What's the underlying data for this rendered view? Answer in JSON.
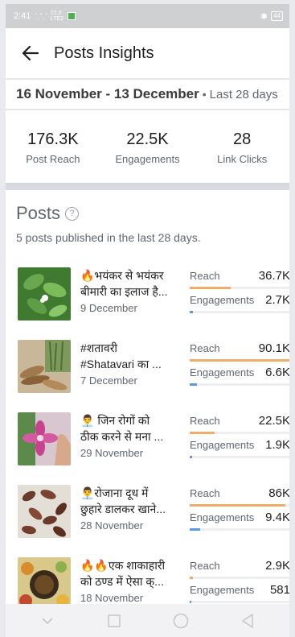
{
  "status_bar": {
    "time": "2:41",
    "signal": "⸪⸪",
    "network_top": "22.0",
    "network_bottom": "LTE2",
    "bluetooth": "✱",
    "battery": "44"
  },
  "header": {
    "title": "Posts Insights"
  },
  "date_range": {
    "dates": "16 November - 13 December",
    "dot": "•",
    "period": "Last 28 days"
  },
  "summary": [
    {
      "value": "176.3K",
      "label": "Post Reach"
    },
    {
      "value": "22.5K",
      "label": "Engagements"
    },
    {
      "value": "28",
      "label": "Link Clicks"
    }
  ],
  "posts_section": {
    "title": "Posts",
    "help": "?",
    "subtitle": "5 posts published in the last 28 days."
  },
  "posts": [
    {
      "line1": "🔥भयंकर से भयंकर",
      "line2": "बीमारी का इलाज है...",
      "date": "9 December",
      "reach_label": "Reach",
      "reach": "36.7K",
      "reach_fraction": 0.41,
      "eng_label": "Engagements",
      "engagements": "2.7K",
      "eng_fraction": 0.03
    },
    {
      "line1": "#शतावरी",
      "line2": "#Shatavari का ...",
      "date": "7 December",
      "reach_label": "Reach",
      "reach": "90.1K",
      "reach_fraction": 1.0,
      "eng_label": "Engagements",
      "engagements": "6.6K",
      "eng_fraction": 0.07
    },
    {
      "line1": "👨‍💼 जिन रोगों को",
      "line2": "ठीक करने से मना ...",
      "date": "29 November",
      "reach_label": "Reach",
      "reach": "22.5K",
      "reach_fraction": 0.25,
      "eng_label": "Engagements",
      "engagements": "1.9K",
      "eng_fraction": 0.02
    },
    {
      "line1": "👨‍💼रोजाना दूध में",
      "line2": "छुहारे डालकर खाने...",
      "date": "28 November",
      "reach_label": "Reach",
      "reach": "86K",
      "reach_fraction": 0.95,
      "eng_label": "Engagements",
      "engagements": "9.4K",
      "eng_fraction": 0.1
    },
    {
      "line1": "🔥🔥एक शाकाहारी",
      "line2": "को ठण्ड में ऐसा क्...",
      "date": "18 November",
      "reach_label": "Reach",
      "reach": "2.9K",
      "reach_fraction": 0.03,
      "eng_label": "Engagements",
      "engagements": "581",
      "eng_fraction": 0.006
    }
  ],
  "colors": {
    "reach_bar": "#f0ad67",
    "engagement_bar": "#5a9ae2"
  },
  "nav_icons": [
    "chevron-down-icon",
    "square-icon",
    "circle-icon",
    "triangle-back-icon"
  ]
}
